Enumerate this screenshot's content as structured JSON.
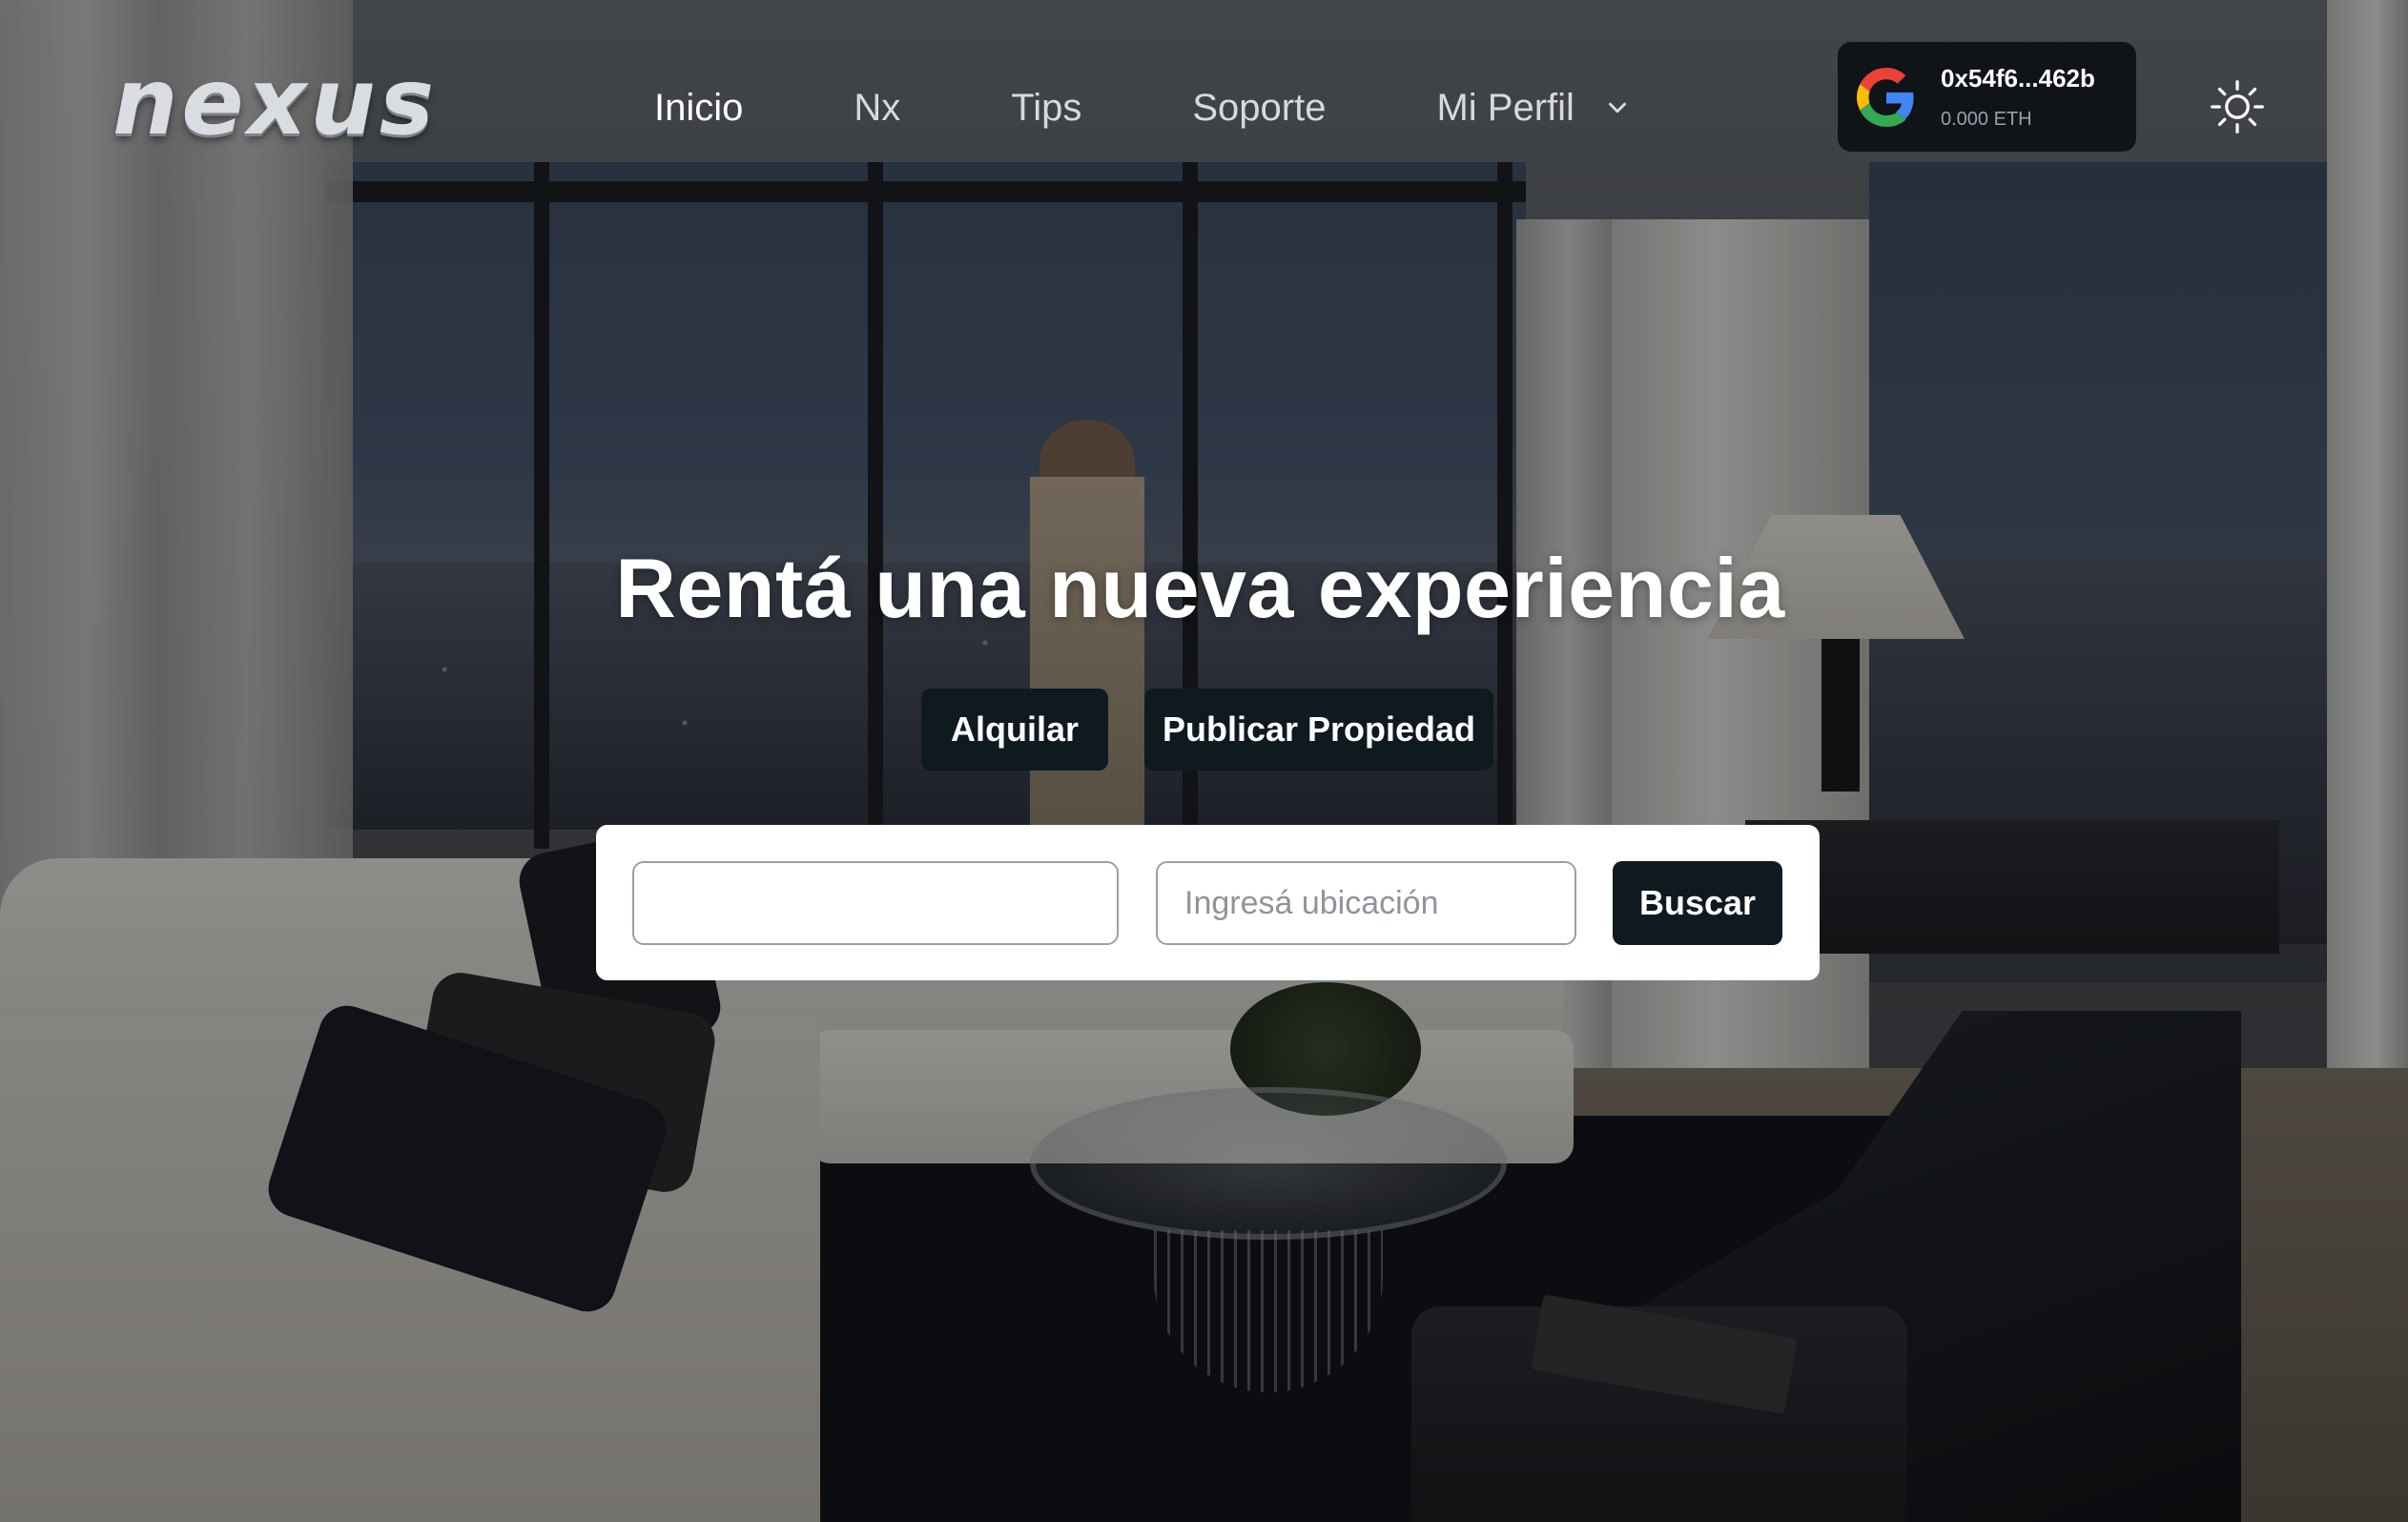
{
  "header": {
    "logo_text": "nexus",
    "nav": [
      {
        "label": "Inicio",
        "active": true
      },
      {
        "label": "Nx",
        "active": false
      },
      {
        "label": "Tips",
        "active": false
      },
      {
        "label": "Soporte",
        "active": false
      },
      {
        "label": "Mi Perfil",
        "active": false
      }
    ],
    "profile_icon": "chevron-down-icon",
    "wallet": {
      "provider_icon": "google-icon",
      "address": "0x54f6...462b",
      "balance": "0.000 ETH"
    },
    "theme_icon": "sun-icon"
  },
  "hero": {
    "title": "Rentá una nueva experiencia",
    "buttons": {
      "rent": "Alquilar",
      "publish": "Publicar Propiedad"
    }
  },
  "search": {
    "first_value": "",
    "first_placeholder": "",
    "location_placeholder": "Ingresá ubicación",
    "button": "Buscar"
  },
  "colors": {
    "button_bg": "#0f1a20",
    "panel_bg": "#ffffff",
    "text_light": "#ffffff"
  }
}
